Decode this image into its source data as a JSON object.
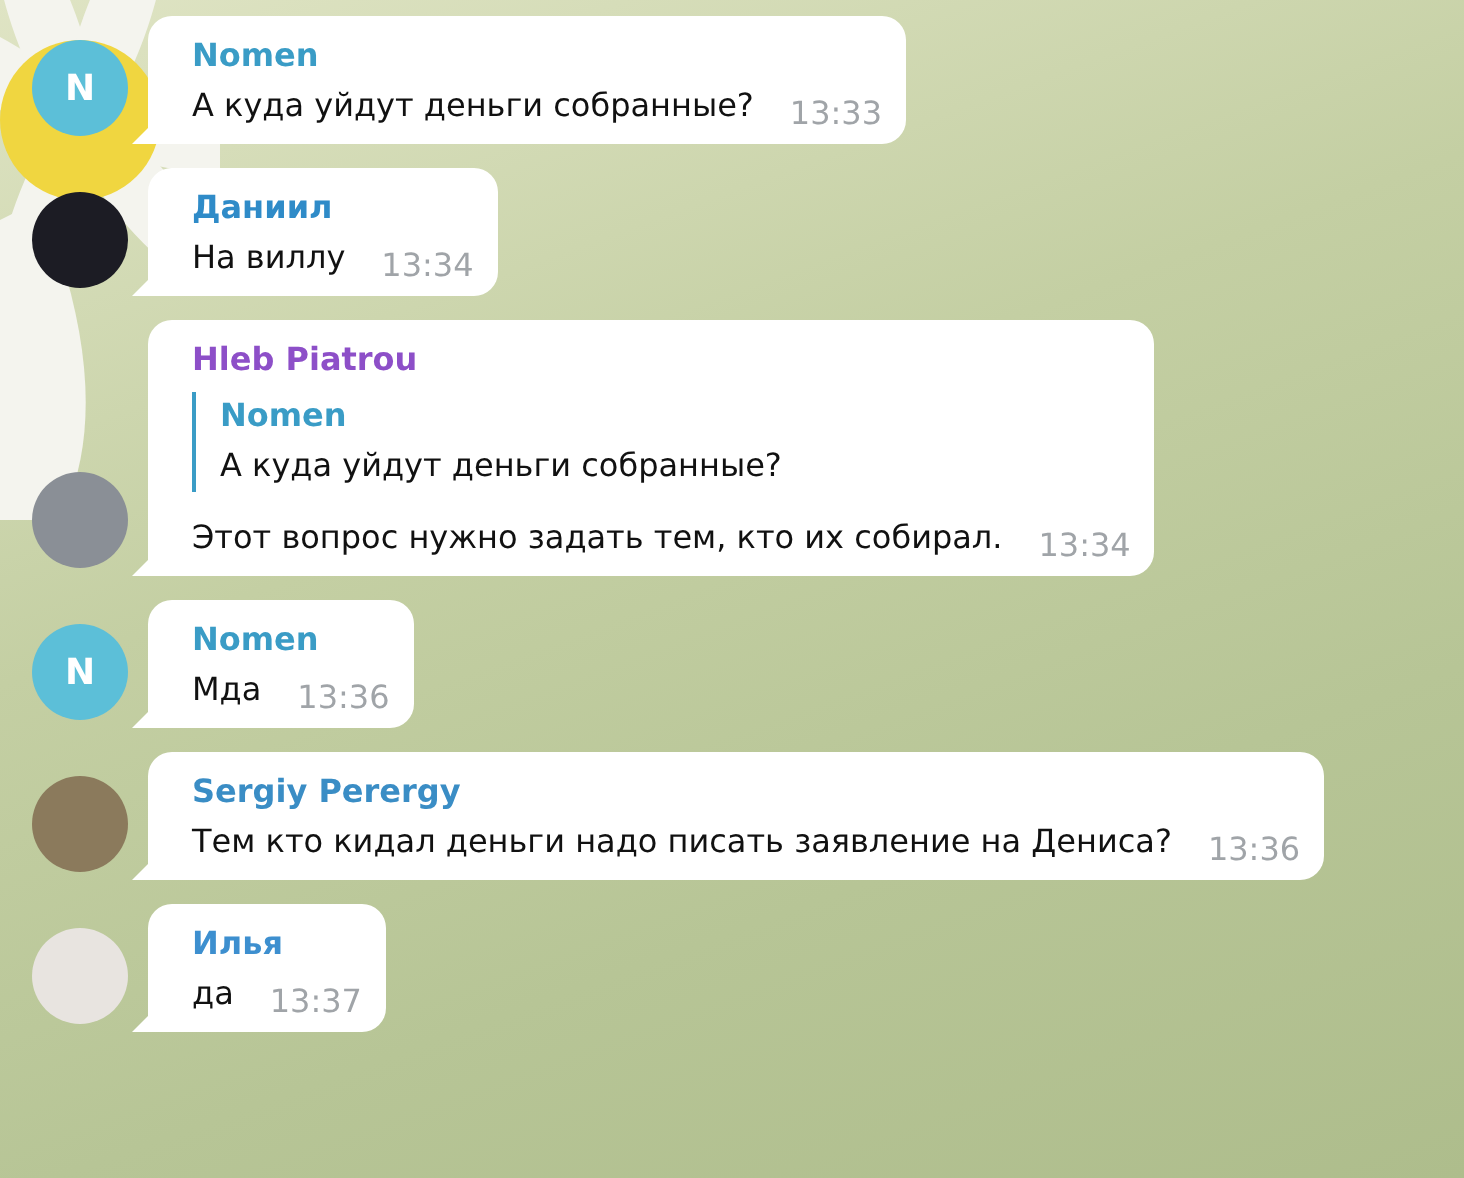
{
  "messages": [
    {
      "author": "Nomen",
      "color": "#3a9cc6",
      "avatar": {
        "kind": "letter",
        "letter": "N",
        "color": "#5cbfd8"
      },
      "text": "А куда уйдут деньги собранные?",
      "time": "13:33"
    },
    {
      "author": "Даниил",
      "color": "#2f8bc8",
      "avatar": {
        "kind": "photo",
        "color": "#1c1c24"
      },
      "text": "На виллу",
      "time": "13:34"
    },
    {
      "author": "Hleb Piatrou",
      "color": "#8d4fc8",
      "avatar": {
        "kind": "photo",
        "color": "#8a8f96"
      },
      "reply": {
        "author": "Nomen",
        "text": "А куда уйдут деньги собранные?"
      },
      "text": "Этот вопрос нужно задать тем, кто их собирал.",
      "time": "13:34"
    },
    {
      "author": "Nomen",
      "color": "#3a9cc6",
      "avatar": {
        "kind": "letter",
        "letter": "N",
        "color": "#5cbfd8"
      },
      "text": "Мда",
      "time": "13:36"
    },
    {
      "author": "Sergiy Perergy",
      "color": "#3a8dc5",
      "avatar": {
        "kind": "photo",
        "color": "#8b7a5c"
      },
      "text": "Тем кто кидал деньги надо писать заявление  на Дениса?",
      "time": "13:36"
    },
    {
      "author": "Илья",
      "color": "#3d8fcf",
      "avatar": {
        "kind": "photo",
        "color": "#e8e4e0"
      },
      "text": "да",
      "time": "13:37"
    }
  ]
}
